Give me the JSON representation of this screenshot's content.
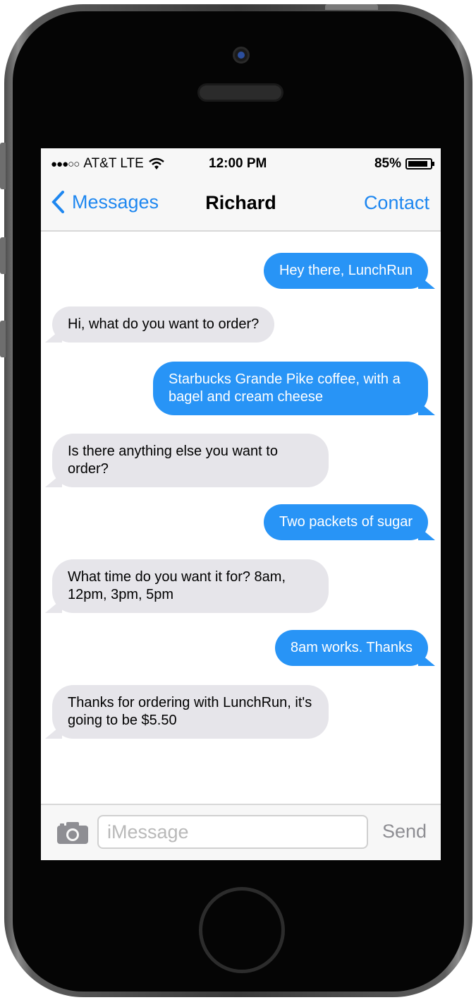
{
  "status_bar": {
    "signal": "●●●○○",
    "carrier": "AT&T LTE",
    "time": "12:00 PM",
    "battery": "85%"
  },
  "nav": {
    "back_label": "Messages",
    "title": "Richard",
    "contact_label": "Contact"
  },
  "messages": [
    {
      "direction": "out",
      "text": "Hey there, LunchRun"
    },
    {
      "direction": "in",
      "text": "Hi, what do you want to order?"
    },
    {
      "direction": "out",
      "text": "Starbucks Grande Pike coffee, with a bagel and cream cheese"
    },
    {
      "direction": "in",
      "text": "Is there anything else you want to order?"
    },
    {
      "direction": "out",
      "text": "Two packets of sugar"
    },
    {
      "direction": "in",
      "text": "What time do you want it for? 8am, 12pm, 3pm, 5pm"
    },
    {
      "direction": "out",
      "text": "8am works. Thanks"
    },
    {
      "direction": "in",
      "text": "Thanks for ordering with LunchRun, it's going to be $5.50"
    }
  ],
  "composer": {
    "placeholder": "iMessage",
    "value": "",
    "send_label": "Send"
  },
  "colors": {
    "accent": "#1e87f0",
    "outgoing_bubble": "#2894f6",
    "incoming_bubble": "#e6e5ea"
  }
}
